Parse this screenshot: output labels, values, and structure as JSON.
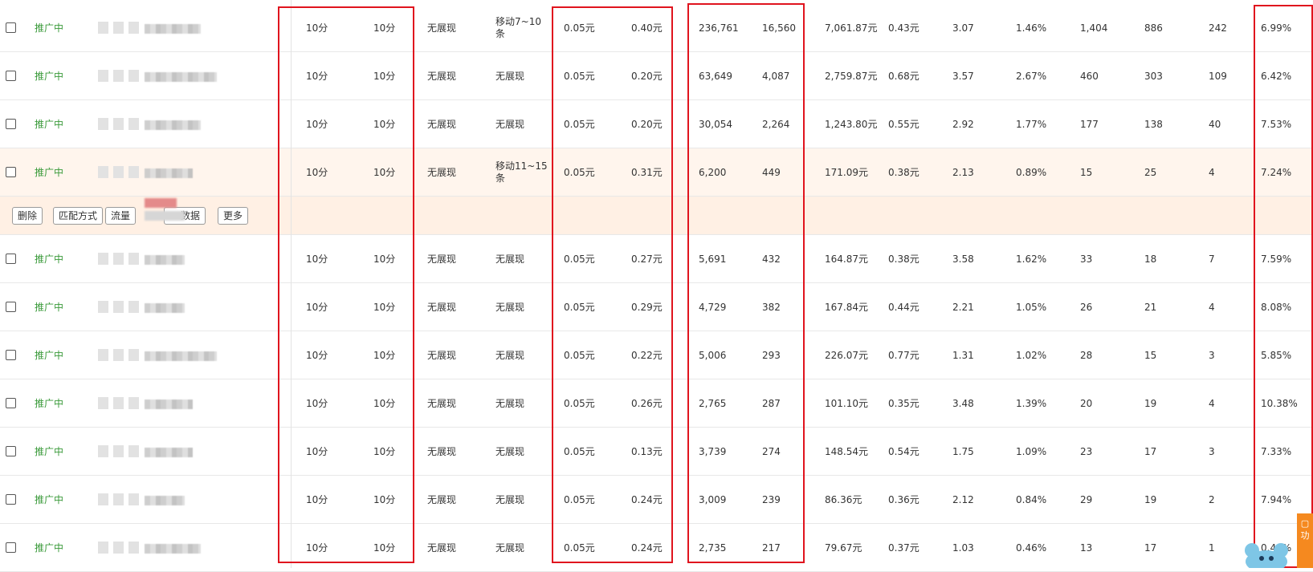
{
  "actions": {
    "delete": "删除",
    "match": "匹配方式",
    "traffic": "流量",
    "data": "数据",
    "more": "更多"
  },
  "rows": [
    {
      "status": "推广中",
      "a": "10分",
      "b": "10分",
      "pc": "无展现",
      "mobile": "移动7~10条",
      "bid1": "0.05元",
      "bid2": "0.40元",
      "impr": "236,761",
      "clicks": "16,560",
      "cost": "7,061.87元",
      "cpc": "0.43元",
      "n1": "3.07",
      "ctr": "1.46%",
      "n2": "1,404",
      "n3": "886",
      "n4": "242",
      "last": "6.99%"
    },
    {
      "status": "推广中",
      "a": "10分",
      "b": "10分",
      "pc": "无展现",
      "mobile": "无展现",
      "bid1": "0.05元",
      "bid2": "0.20元",
      "impr": "63,649",
      "clicks": "4,087",
      "cost": "2,759.87元",
      "cpc": "0.68元",
      "n1": "3.57",
      "ctr": "2.67%",
      "n2": "460",
      "n3": "303",
      "n4": "109",
      "last": "6.42%"
    },
    {
      "status": "推广中",
      "a": "10分",
      "b": "10分",
      "pc": "无展现",
      "mobile": "无展现",
      "bid1": "0.05元",
      "bid2": "0.20元",
      "impr": "30,054",
      "clicks": "2,264",
      "cost": "1,243.80元",
      "cpc": "0.55元",
      "n1": "2.92",
      "ctr": "1.77%",
      "n2": "177",
      "n3": "138",
      "n4": "40",
      "last": "7.53%"
    },
    {
      "status": "推广中",
      "a": "10分",
      "b": "10分",
      "pc": "无展现",
      "mobile": "移动11~15条",
      "bid1": "0.05元",
      "bid2": "0.31元",
      "impr": "6,200",
      "clicks": "449",
      "cost": "171.09元",
      "cpc": "0.38元",
      "n1": "2.13",
      "ctr": "0.89%",
      "n2": "15",
      "n3": "25",
      "n4": "4",
      "last": "7.24%"
    },
    {
      "status": "推广中",
      "a": "10分",
      "b": "10分",
      "pc": "无展现",
      "mobile": "无展现",
      "bid1": "0.05元",
      "bid2": "0.27元",
      "impr": "5,691",
      "clicks": "432",
      "cost": "164.87元",
      "cpc": "0.38元",
      "n1": "3.58",
      "ctr": "1.62%",
      "n2": "33",
      "n3": "18",
      "n4": "7",
      "last": "7.59%"
    },
    {
      "status": "推广中",
      "a": "10分",
      "b": "10分",
      "pc": "无展现",
      "mobile": "无展现",
      "bid1": "0.05元",
      "bid2": "0.29元",
      "impr": "4,729",
      "clicks": "382",
      "cost": "167.84元",
      "cpc": "0.44元",
      "n1": "2.21",
      "ctr": "1.05%",
      "n2": "26",
      "n3": "21",
      "n4": "4",
      "last": "8.08%"
    },
    {
      "status": "推广中",
      "a": "10分",
      "b": "10分",
      "pc": "无展现",
      "mobile": "无展现",
      "bid1": "0.05元",
      "bid2": "0.22元",
      "impr": "5,006",
      "clicks": "293",
      "cost": "226.07元",
      "cpc": "0.77元",
      "n1": "1.31",
      "ctr": "1.02%",
      "n2": "28",
      "n3": "15",
      "n4": "3",
      "last": "5.85%"
    },
    {
      "status": "推广中",
      "a": "10分",
      "b": "10分",
      "pc": "无展现",
      "mobile": "无展现",
      "bid1": "0.05元",
      "bid2": "0.26元",
      "impr": "2,765",
      "clicks": "287",
      "cost": "101.10元",
      "cpc": "0.35元",
      "n1": "3.48",
      "ctr": "1.39%",
      "n2": "20",
      "n3": "19",
      "n4": "4",
      "last": "10.38%"
    },
    {
      "status": "推广中",
      "a": "10分",
      "b": "10分",
      "pc": "无展现",
      "mobile": "无展现",
      "bid1": "0.05元",
      "bid2": "0.13元",
      "impr": "3,739",
      "clicks": "274",
      "cost": "148.54元",
      "cpc": "0.54元",
      "n1": "1.75",
      "ctr": "1.09%",
      "n2": "23",
      "n3": "17",
      "n4": "3",
      "last": "7.33%"
    },
    {
      "status": "推广中",
      "a": "10分",
      "b": "10分",
      "pc": "无展现",
      "mobile": "无展现",
      "bid1": "0.05元",
      "bid2": "0.24元",
      "impr": "3,009",
      "clicks": "239",
      "cost": "86.36元",
      "cpc": "0.36元",
      "n1": "2.12",
      "ctr": "0.84%",
      "n2": "29",
      "n3": "19",
      "n4": "2",
      "last": "7.94%"
    },
    {
      "status": "推广中",
      "a": "10分",
      "b": "10分",
      "pc": "无展现",
      "mobile": "无展现",
      "bid1": "0.05元",
      "bid2": "0.24元",
      "impr": "2,735",
      "clicks": "217",
      "cost": "79.67元",
      "cpc": "0.37元",
      "n1": "1.03",
      "ctr": "0.46%",
      "n2": "13",
      "n3": "17",
      "n4": "1",
      "last": "0.46%"
    }
  ],
  "colors": {
    "status": "#3a9a3a",
    "highlight_box": "#e0141e",
    "row_hover": "#fff5ed",
    "widget": "#f5891f"
  }
}
